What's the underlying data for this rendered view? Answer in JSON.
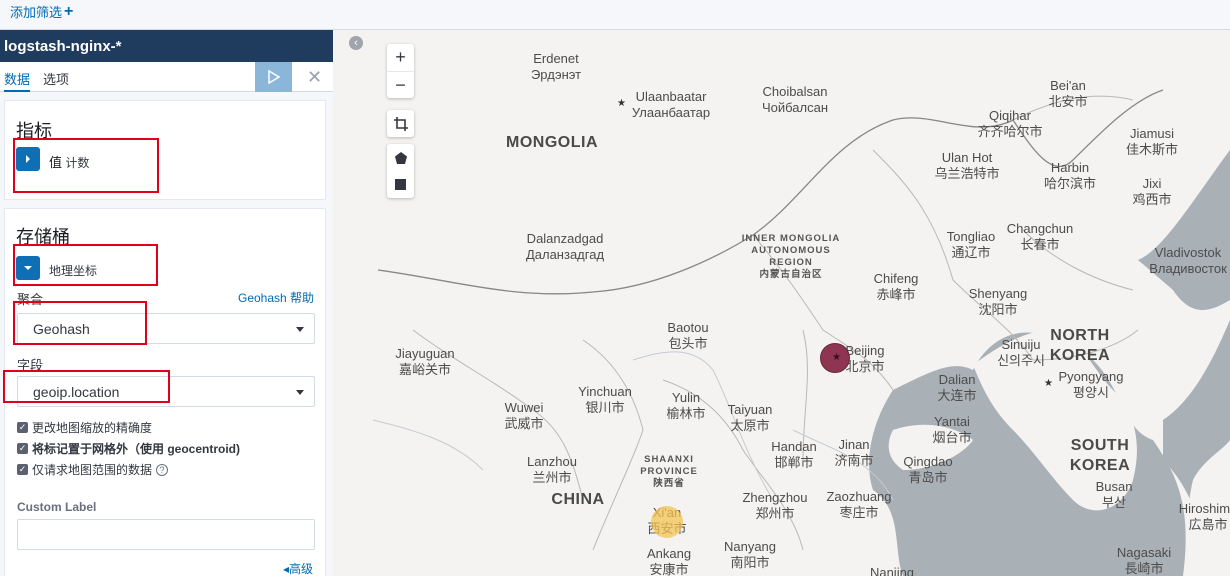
{
  "filter_bar": {
    "add_filter_label": "添加筛选",
    "add_filter_icon": "plus-icon"
  },
  "sidebar": {
    "index_pattern": "logstash-nginx-*",
    "tabs": [
      {
        "label": "数据",
        "active": true
      },
      {
        "label": "选项",
        "active": false
      }
    ],
    "apply_icon": "play-icon",
    "discard_icon": "close-icon",
    "metrics": {
      "title": "指标",
      "agg_prefix": "值",
      "agg_label": "计数"
    },
    "buckets": {
      "title": "存储桶",
      "agg_label": "地理坐标",
      "aggregation_label": "聚合",
      "help_link": "Geohash 帮助",
      "aggregation_value": "Geohash",
      "field_label": "字段",
      "field_value": "geoip.location",
      "options": [
        {
          "label": "更改地图缩放的精确度",
          "checked": true
        },
        {
          "label": "将标记置于网格外（使用 geocentroid)",
          "checked": true
        },
        {
          "label": "仅请求地图范围的数据",
          "checked": true
        }
      ],
      "custom_label_title": "Custom Label",
      "custom_label_value": "",
      "advanced_link": "高级"
    }
  },
  "map": {
    "zoom_in": "+",
    "zoom_out": "−",
    "colors": {
      "water": "#a9b0b6",
      "land": "#f4f3f1",
      "marker_high": "#8a2a4a",
      "marker_low": "#f5c452"
    },
    "countries": [
      "MONGOLIA",
      "CHINA",
      "NORTH\nKOREA",
      "SOUTH\nKOREA"
    ],
    "regions": [
      {
        "text": "INNER MONGOLIA\nAUTONOMOUS\nREGION\n内蒙古自治区"
      },
      {
        "text": "SHAANXI\nPROVINCE\n陕西省"
      }
    ],
    "cities": [
      "Erdenet\nЭрдэнэт",
      "Ulaanbaatar\nУлаанбаатар",
      "Choibalsan\nЧойбалсан",
      "Bei'an\n北安市",
      "Qiqihar\n齐齐哈尔市",
      "Jiamusi\n佳木斯市",
      "Ulan Hot\n乌兰浩特市",
      "Harbin\n哈尔滨市",
      "Jixi\n鸡西市",
      "Dalanzadgad\nДаланзадгад",
      "Tongliao\n通辽市",
      "Changchun\n长春市",
      "Vladivostok\nВладивосток",
      "Chifeng\n赤峰市",
      "Shenyang\n沈阳市",
      "Baotou\n包头市",
      "Beijing\n北京市",
      "Sinuiju\n신의주시",
      "Jiayuguan\n嘉峪关市",
      "Dalian\n大连市",
      "Pyongyang\n평양시",
      "Yinchuan\n银川市",
      "Yulin\n榆林市",
      "Wuwei\n武威市",
      "Taiyuan\n太原市",
      "Yantai\n烟台市",
      "Handan\n邯郸市",
      "Jinan\n济南市",
      "Qingdao\n青岛市",
      "Lanzhou\n兰州市",
      "Busan\n부산",
      "Zhengzhou\n郑州市",
      "Zaozhuang\n枣庄市",
      "Hiroshima\n広島市",
      "Xi'an\n西安市",
      "Ankang\n安康市",
      "Nanyang\n南阳市",
      "Nagasaki\n長崎市",
      "Nanjing"
    ],
    "markers": [
      {
        "city": "Beijing",
        "level": "high"
      },
      {
        "city": "Xi'an",
        "level": "low"
      }
    ]
  }
}
